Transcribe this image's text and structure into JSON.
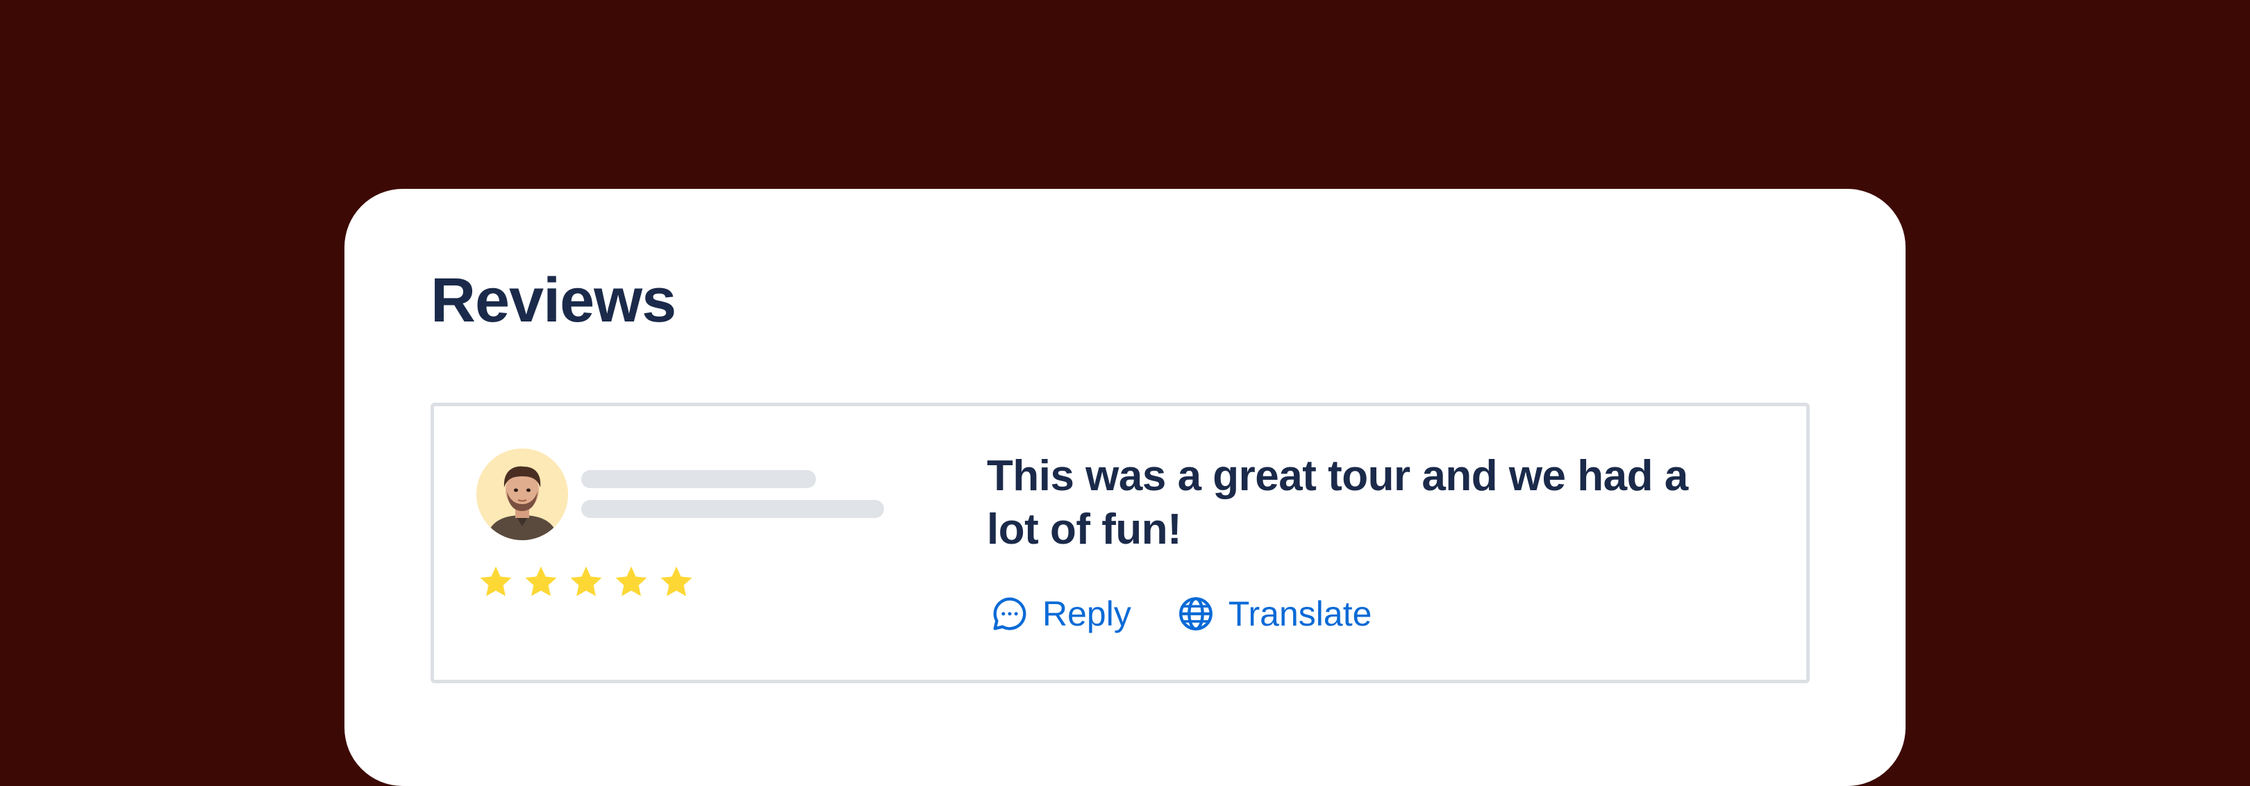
{
  "reviews": {
    "title": "Reviews",
    "item": {
      "rating": 5,
      "rating_max": 5,
      "text": "This was a great tour and we had a lot of fun!",
      "actions": {
        "reply_label": "Reply",
        "translate_label": "Translate"
      }
    }
  },
  "colors": {
    "background": "#3d0904",
    "card": "#ffffff",
    "heading": "#1b2a4a",
    "link": "#0a6ad6",
    "star": "#fdd835",
    "skeleton": "#e0e3e7",
    "avatar_bg": "#fde9b6"
  },
  "icons": {
    "reply": "chat-bubble-icon",
    "translate": "globe-icon",
    "rating": "star-icon"
  }
}
